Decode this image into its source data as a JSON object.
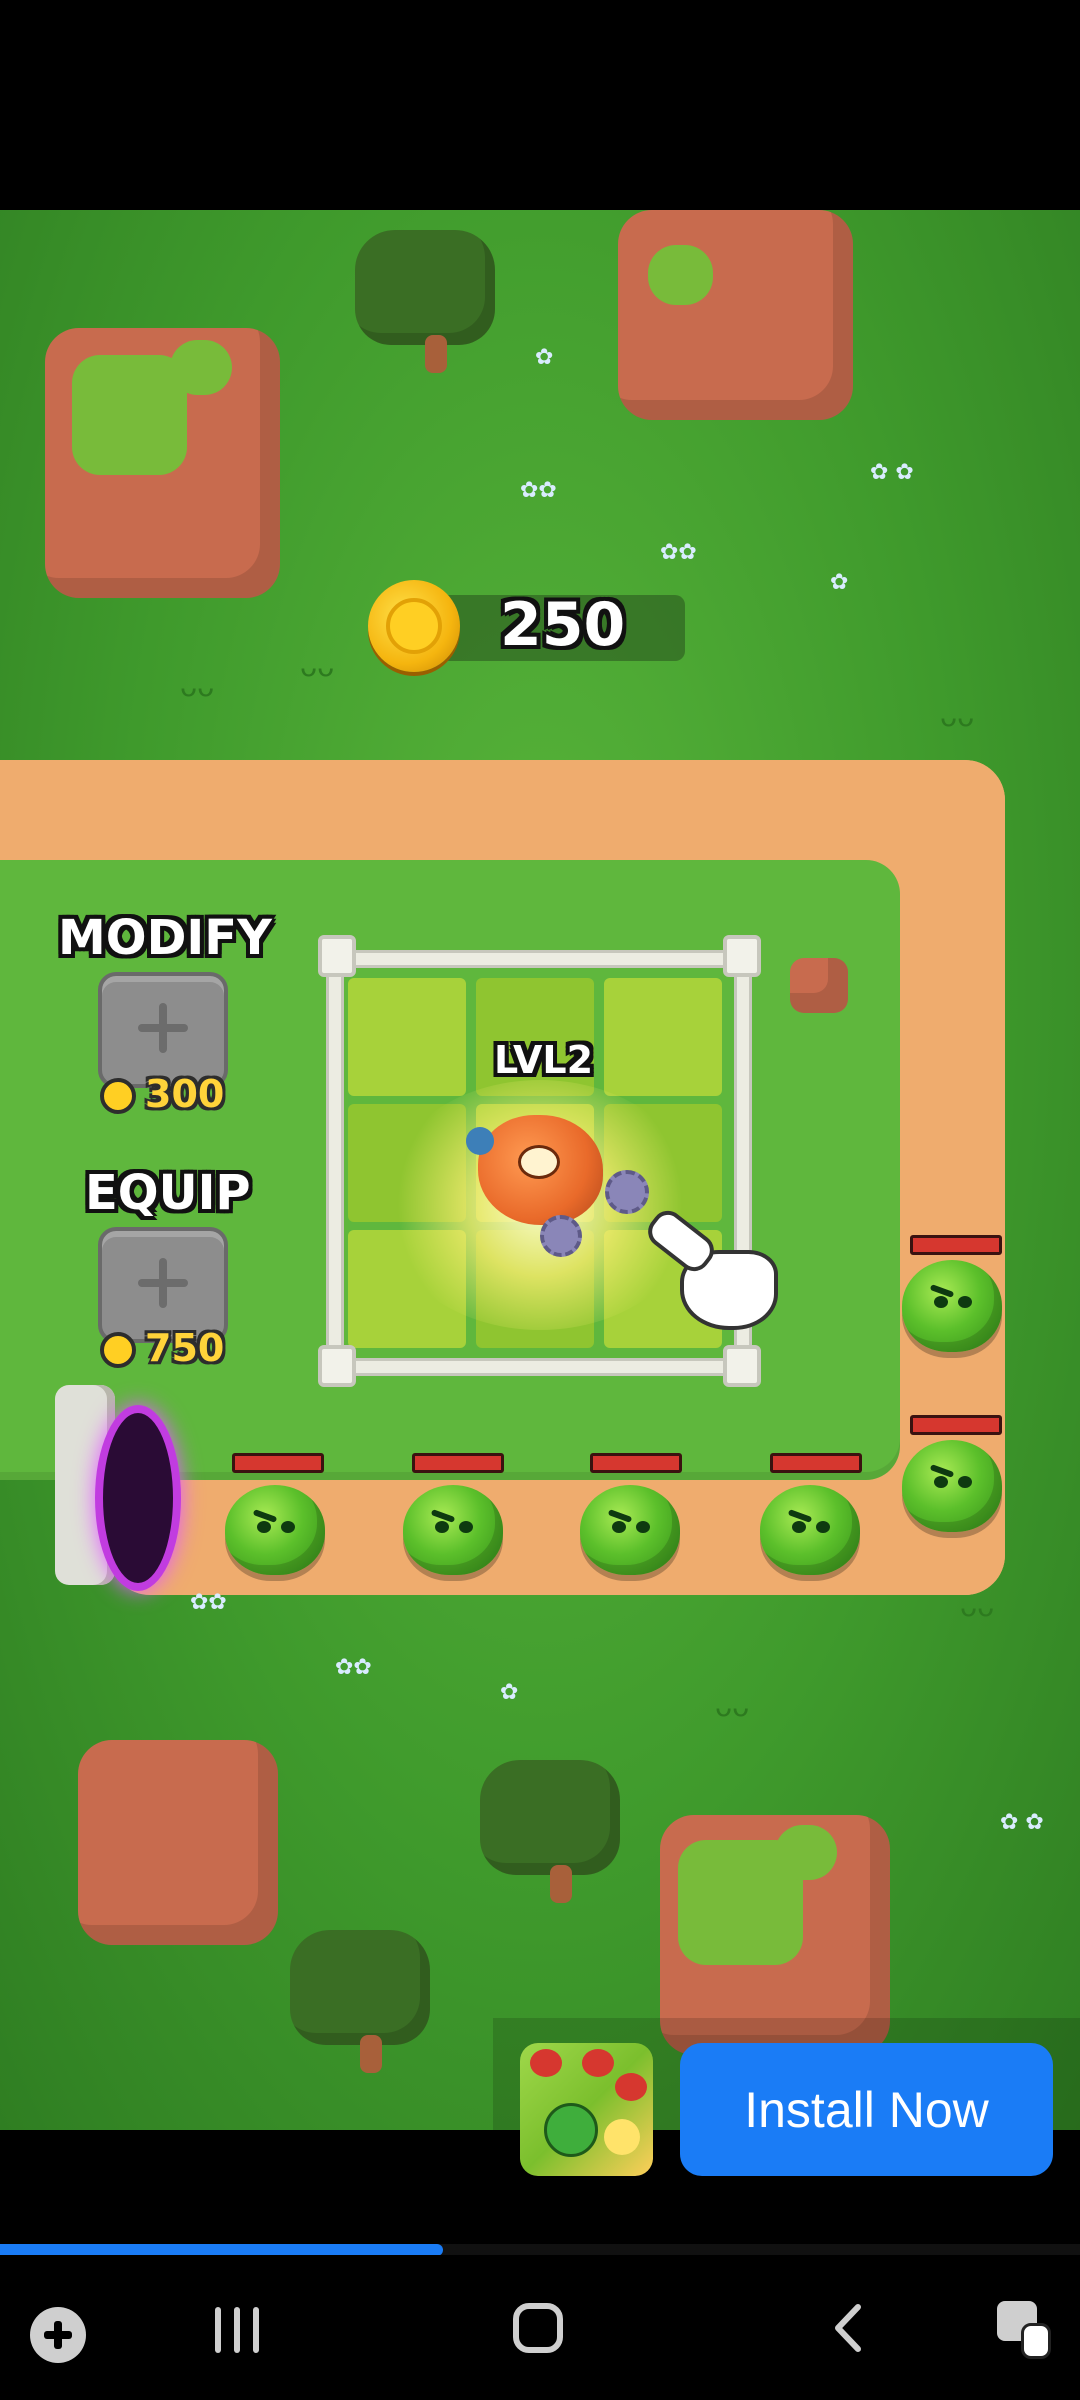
{
  "game": {
    "coin_balance": "250",
    "modify": {
      "label": "MODIFY",
      "cost": "300"
    },
    "equip": {
      "label": "EQUIP",
      "cost": "750"
    },
    "hero_level": "LVL2",
    "enemies_count": 6
  },
  "ad": {
    "install_label": "Install Now",
    "progress": 0.41
  },
  "system_nav": {
    "items": [
      "game-launcher",
      "recent-apps",
      "home",
      "back",
      "accessibility"
    ]
  },
  "colors": {
    "install_button": "#1a7cf6",
    "progress_bar": "#1a7cf6",
    "coin": "#ffcf23",
    "path": "#efac6e",
    "grass": "#4fa932"
  }
}
